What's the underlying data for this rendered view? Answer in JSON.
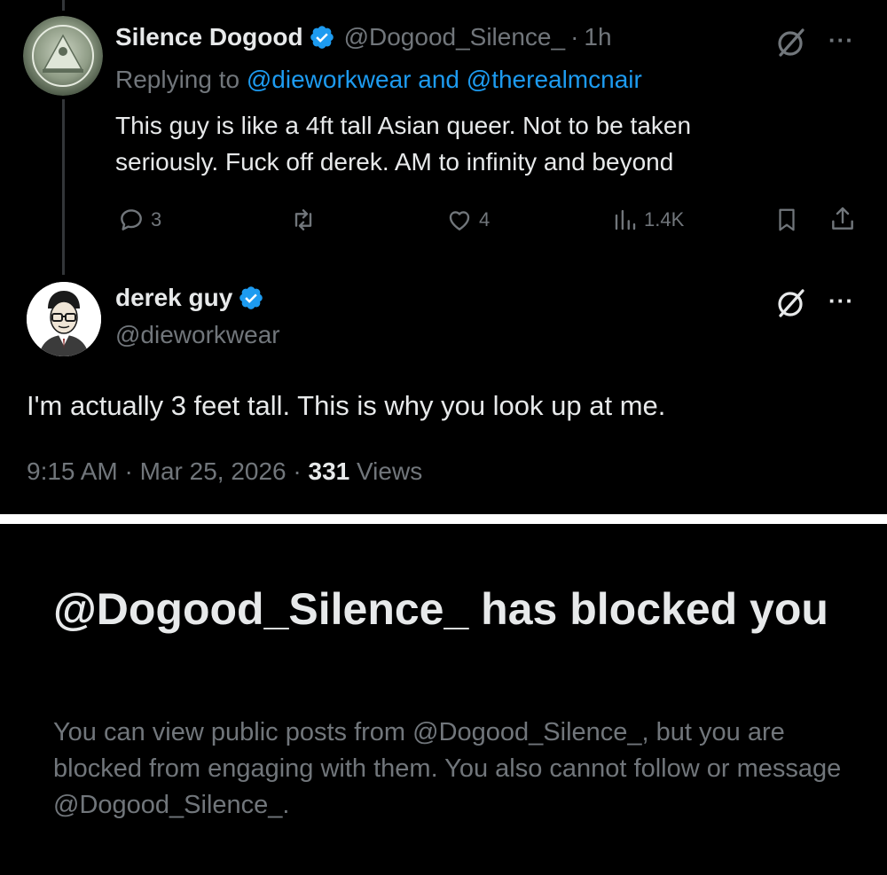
{
  "reply_tweet": {
    "author_name": "Silence Dogood",
    "author_handle": "@Dogood_Silence_",
    "time": "1h",
    "replying_prefix": "Replying to",
    "replying_to_1": "@dieworkwear",
    "replying_and": "and",
    "replying_to_2": "@therealmcnair",
    "text_line1": "This guy is like a 4ft tall Asian queer. Not to be taken",
    "text_line2": "seriously. Fuck off derek. AM to infinity and beyond",
    "replies": "3",
    "likes": "4",
    "views": "1.4K",
    "icons": [
      "reply-icon",
      "retweet-icon",
      "like-icon",
      "views-icon",
      "bookmark-icon",
      "share-icon",
      "grok-icon",
      "more-icon"
    ]
  },
  "main_tweet": {
    "author_name": "derek guy",
    "author_handle": "@dieworkwear",
    "text": "I'm actually 3 feet tall. This is why you look up at me.",
    "time": "9:15 AM",
    "date": "Mar 25, 2026",
    "views_count": "331",
    "views_label": "Views"
  },
  "block_notice": {
    "title": "@Dogood_Silence_ has blocked you",
    "description": "You can view public posts from @Dogood_Silence_, but you are blocked from engaging with them. You also cannot follow or message @Dogood_Silence_."
  },
  "colors": {
    "background": "#000000",
    "text": "#e7e9ea",
    "muted": "#71767b",
    "link": "#1d9bf0",
    "verified": "#1d9bf0",
    "divider": "#ffffff"
  }
}
